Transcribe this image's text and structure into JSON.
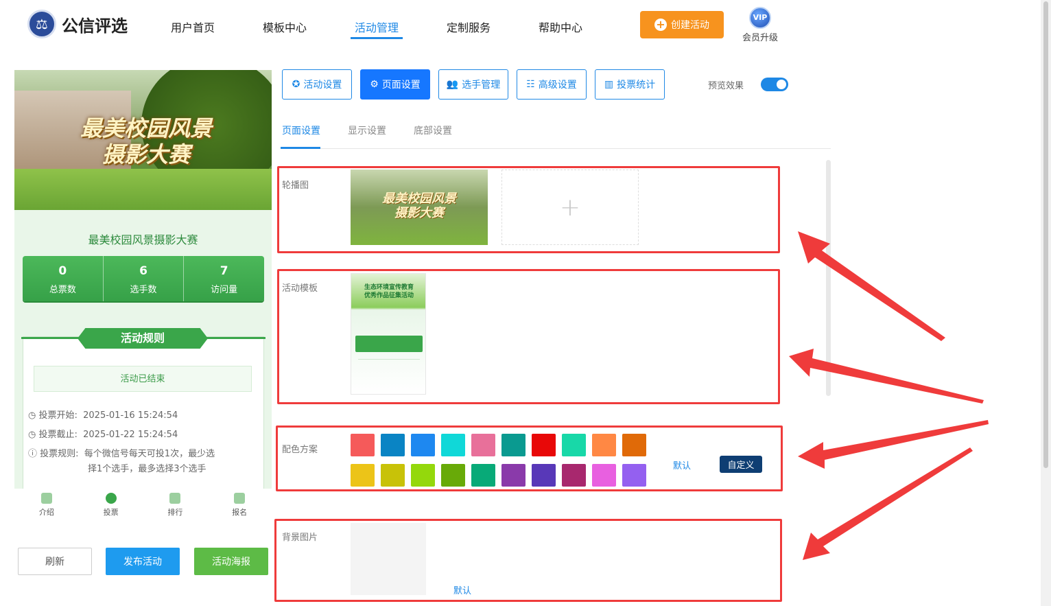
{
  "brand": {
    "name": "公信评选"
  },
  "nav": [
    {
      "label": "用户首页"
    },
    {
      "label": "模板中心"
    },
    {
      "label": "活动管理"
    },
    {
      "label": "定制服务"
    },
    {
      "label": "帮助中心"
    }
  ],
  "header": {
    "create_label": "创建活动",
    "vip_badge": "VIP",
    "vip_label": "会员升级"
  },
  "preview": {
    "banner_title_line1": "最美校园风景",
    "banner_title_line2": "摄影大赛",
    "activity_name": "最美校园风景摄影大赛",
    "stats": [
      {
        "value": "0",
        "label": "总票数"
      },
      {
        "value": "6",
        "label": "选手数"
      },
      {
        "value": "7",
        "label": "访问量"
      }
    ],
    "rules_title": "活动规则",
    "status": "活动已结束",
    "vote_start_label": "投票开始:",
    "vote_start_value": "2025-01-16 15:24:54",
    "vote_end_label": "投票截止:",
    "vote_end_value": "2025-01-22 15:24:54",
    "rule_label": "投票规则:",
    "rule_value_line1": "每个微信号每天可投1次，最少选",
    "rule_value_line2": "择1个选手，最多选择3个选手",
    "tabs": [
      {
        "label": "介绍"
      },
      {
        "label": "投票"
      },
      {
        "label": "排行"
      },
      {
        "label": "报名"
      }
    ]
  },
  "left_buttons": {
    "refresh": "刷新",
    "publish": "发布活动",
    "poster": "活动海报"
  },
  "toolbar": [
    {
      "label": "活动设置",
      "icon": "star-icon"
    },
    {
      "label": "页面设置",
      "icon": "gear-icon"
    },
    {
      "label": "选手管理",
      "icon": "users-icon"
    },
    {
      "label": "高级设置",
      "icon": "sliders-icon"
    },
    {
      "label": "投票统计",
      "icon": "bar-chart-icon"
    }
  ],
  "preview_toggle": {
    "label": "预览效果",
    "on": true
  },
  "subtabs": [
    {
      "label": "页面设置"
    },
    {
      "label": "显示设置"
    },
    {
      "label": "底部设置"
    }
  ],
  "sections": {
    "carousel_label": "轮播图",
    "carousel_thumb_line1": "最美校园风景",
    "carousel_thumb_line2": "摄影大赛",
    "template_label": "活动模板",
    "template_thumb_line1": "生态环境宣传教育",
    "template_thumb_line2": "优秀作品征集活动",
    "color_label": "配色方案",
    "color_default": "默认",
    "color_custom": "自定义",
    "bg_label": "背景图片",
    "bg_default": "默认"
  },
  "colors_row1": [
    "#f55a5a",
    "#0a84c4",
    "#1e88f0",
    "#10d8d8",
    "#e8709a",
    "#0a9a90",
    "#e80808",
    "#18d8a8",
    "#ff8844",
    "#e06a08"
  ],
  "colors_row2": [
    "#ecc418",
    "#c8c208",
    "#94d80c",
    "#68aa08",
    "#08aa78",
    "#8a3aaa",
    "#5838b8",
    "#a8286e",
    "#e860e0",
    "#9460f0"
  ],
  "accent": "#1e88e5",
  "annotation_color": "#ef3b3b"
}
